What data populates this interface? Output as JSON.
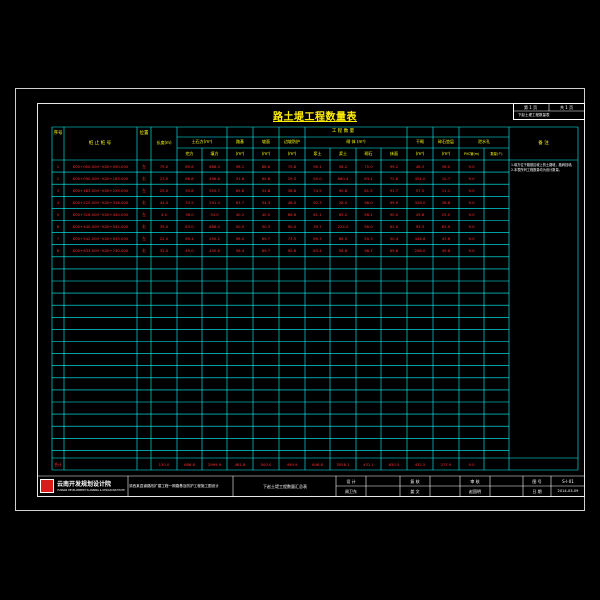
{
  "title": "路土堤工程数量表",
  "sheet_box": {
    "sheet_label": "第 1 页",
    "total_label": "共 1 页",
    "sub_label": "下赵土堤工程数量表"
  },
  "headers": {
    "seq": "序号",
    "stake": "桩 止 桩 号",
    "position": "位置",
    "length": "长度(m)",
    "work_qty": "工 程 数 量",
    "earthwork": "土石方(m³)",
    "excavation": "挖方",
    "fill": "填方",
    "subgrade": "路基",
    "slope": "坡面",
    "drainage": "边坡防护",
    "masonry": "砌 体 (m³)",
    "m_a": "浆土",
    "m_b": "浆土",
    "m_c": "砌石",
    "m_d": "抹面",
    "dry": "干砌",
    "gravel": "碎石垫层",
    "drain_hole": "泄水孔",
    "remark": "备 注",
    "unit_cut": "挖方",
    "unit_fill": "填方",
    "unit_a": "(m³)",
    "unit_b": "(m³)",
    "unit_c": "(m³)",
    "unit_dry": "(m³)",
    "unit_gravel": "(m³)",
    "unit_pipe": "PVC管(m)",
    "unit_count": "数量(个)"
  },
  "rows": [
    {
      "seq": "1",
      "stake": "K00+000.000~K00+090.000",
      "side": "左",
      "vals": [
        "75.0",
        "89.6",
        "688.0",
        "98.1",
        "88.6",
        "70.8",
        "90.1",
        "58.2",
        "75.0",
        "99.2",
        "48.3",
        "36.0",
        "9.0"
      ]
    },
    {
      "seq": "2",
      "stake": "K00+090.000~K00+183.000",
      "side": "右",
      "vals": [
        "23.0",
        "66.8",
        "496.6",
        "31.6",
        "60.8",
        "29.5",
        "50.0",
        "660.4",
        "63.1",
        "72.6",
        "451.0",
        "10.7",
        "9.0"
      ]
    },
    {
      "seq": "3",
      "stake": "K00+183.000~K00+225.000",
      "side": "左",
      "vals": [
        "25.0",
        "55.8",
        "555.7",
        "65.8",
        "54.8",
        "38.8",
        "74.5",
        "90.8",
        "81.5",
        "91.7",
        "57.5",
        "11.1",
        "9.0"
      ]
    },
    {
      "seq": "4",
      "stake": "K00+225.000~K00+316.000",
      "side": "右",
      "vals": [
        "44.0",
        "33.5",
        "291.4",
        "63.7",
        "54.3",
        "48.0",
        "92.3",
        "28.0",
        "98.0",
        "99.9",
        "328.0",
        "38.8",
        "9.0"
      ]
    },
    {
      "seq": "5",
      "stake": "K00+316.000~K00+440.000",
      "side": "左",
      "vals": [
        "4.0",
        "38.0",
        "34.0",
        "40.2",
        "40.5",
        "66.6",
        "61.1",
        "65.2",
        "58.1",
        "90.0",
        "45.8",
        "25.0",
        "9.0"
      ]
    },
    {
      "seq": "6",
      "stake": "K00+440.000~K00+542.000",
      "side": "右",
      "vals": [
        "35.0",
        "83.0",
        "688.0",
        "50.0",
        "50.3",
        "90.0",
        "39.7",
        "224.0",
        "56.0",
        "62.0",
        "93.3",
        "63.9",
        "9.0"
      ]
    },
    {
      "seq": "7",
      "stake": "K00+542.000~K00+633.000",
      "side": "左",
      "vals": [
        "22.0",
        "69.4",
        "290.2",
        "96.0",
        "69.7",
        "73.5",
        "89.3",
        "68.5",
        "50.3",
        "50.4",
        "448.8",
        "43.6",
        "9.0"
      ]
    },
    {
      "seq": "8",
      "stake": "K00+633.000~K00+740.000",
      "side": "右",
      "vals": [
        "32.0",
        "49.0",
        "445.8",
        "56.4",
        "89.7",
        "95.6",
        "83.4",
        "58.8",
        "98.7",
        "69.6",
        "298.0",
        "49.8",
        "9.0"
      ]
    }
  ],
  "total": {
    "label": "合计",
    "vals": [
      "130.0",
      "686.8",
      "2999.9",
      "481.8",
      "500.0",
      "499.9",
      "646.8",
      "3558.1",
      "431.1",
      "630.5",
      "432.5",
      "277.9",
      "9.0"
    ]
  },
  "remark_text": "1.填方位于路基边坡上的土路堤，路肩挡墙,\n2.本表所列工程数量均为设计数量。",
  "title_block": {
    "company": "云南开发规划设计院",
    "company_sub": "YUNNAN DEVELOPMENT PLANNING & DESIGN INSTITUTE",
    "project": "滇西某县道路改扩建工程一期路基及防护工程施工图设计",
    "drawing": "下赵土堤工程数量汇总表",
    "designer_label": "设 计",
    "designer": "周卫东",
    "reviewer_label": "复 核",
    "reviewer": "姜 文",
    "checker_label": "审 核",
    "checker": "赵国明",
    "drawing_no_label": "图 号",
    "drawing_no": "S-I-01",
    "date_label": "日 期",
    "date": "2014-03-09"
  },
  "colors": {
    "background": "#000000",
    "grid": "#00ffff",
    "header_text": "#ffff00",
    "data_text": "#ff3030",
    "title": "#ffee00",
    "frame": "#ffffff"
  }
}
